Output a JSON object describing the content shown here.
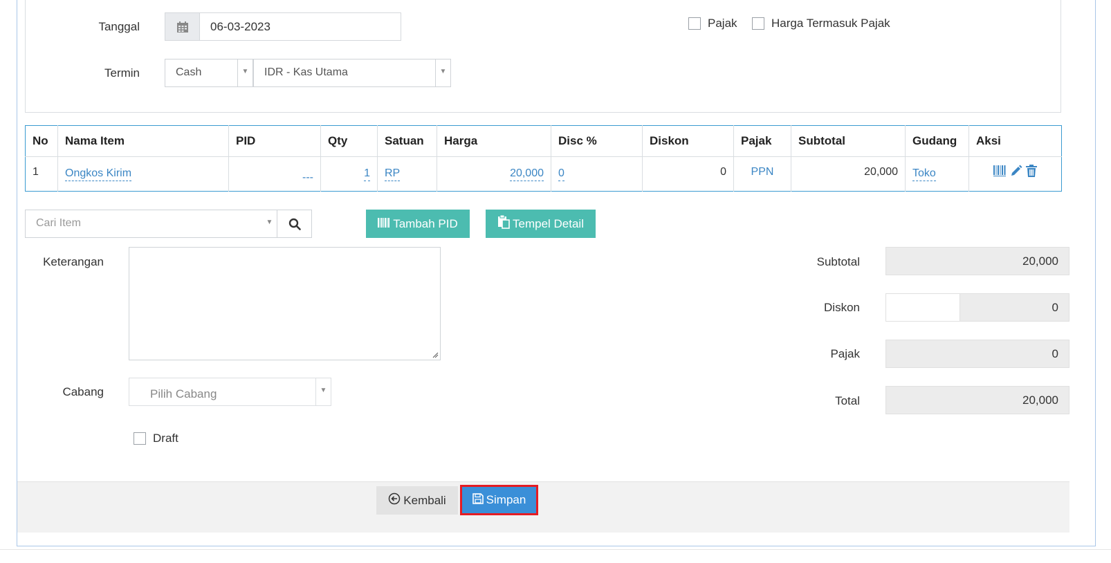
{
  "form": {
    "tanggal_label": "Tanggal",
    "tanggal_value": "06-03-2023",
    "termin_label": "Termin",
    "termin_value": "Cash",
    "account_value": "IDR - Kas Utama",
    "pajak_label": "Pajak",
    "harga_termasuk_pajak_label": "Harga Termasuk Pajak"
  },
  "table": {
    "headers": [
      "No",
      "Nama Item",
      "PID",
      "Qty",
      "Satuan",
      "Harga",
      "Disc %",
      "Diskon",
      "Pajak",
      "Subtotal",
      "Gudang",
      "Aksi"
    ],
    "rows": [
      {
        "no": "1",
        "nama": "Ongkos Kirim",
        "pid": "---",
        "qty": "1",
        "satuan": "RP",
        "harga": "20,000",
        "disc": "0",
        "diskon": "0",
        "pajak": "PPN",
        "subtotal": "20,000",
        "gudang": "Toko"
      }
    ]
  },
  "search": {
    "placeholder": "Cari Item"
  },
  "buttons": {
    "tambah_pid": "Tambah PID",
    "tempel_detail": "Tempel Detail",
    "kembali": "Kembali",
    "simpan": "Simpan"
  },
  "keterangan_label": "Keterangan",
  "cabang": {
    "label": "Cabang",
    "placeholder": "Pilih Cabang"
  },
  "draft_label": "Draft",
  "summary": {
    "subtotal_label": "Subtotal",
    "subtotal_value": "20,000",
    "diskon_label": "Diskon",
    "diskon_value": "0",
    "pajak_label": "Pajak",
    "pajak_value": "0",
    "total_label": "Total",
    "total_value": "20,000"
  },
  "colors": {
    "accent": "#3a8fd8",
    "teal": "#4cbcb0",
    "highlight": "#e51c23",
    "link": "#3b86c4"
  }
}
